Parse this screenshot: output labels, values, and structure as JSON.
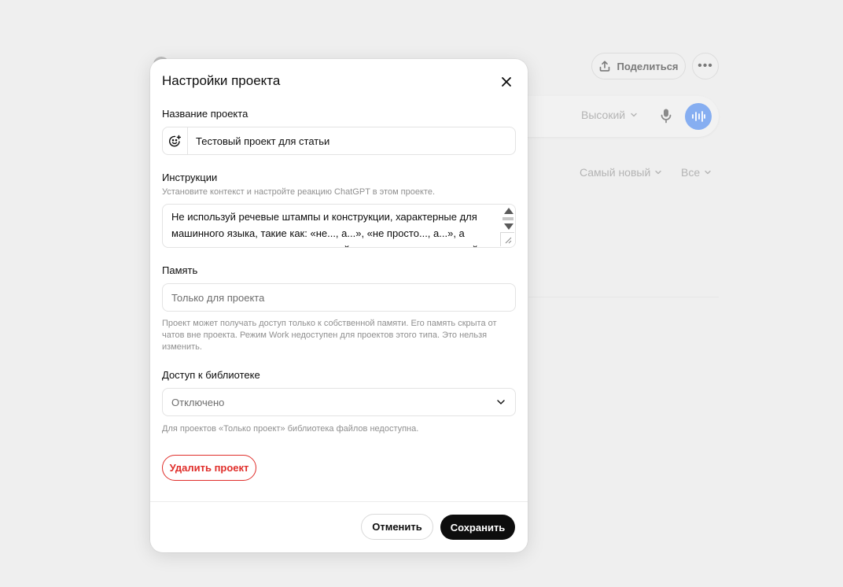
{
  "background": {
    "share_label": "Поделиться",
    "more_label": "•••",
    "level_label": "Высокий",
    "sort_label": "Самый новый",
    "filter_label": "Все",
    "voice_color": "#86aef1"
  },
  "modal": {
    "title": "Настройки проекта",
    "name": {
      "label": "Название проекта",
      "value": "Тестовый проект для статьи"
    },
    "instructions": {
      "label": "Инструкции",
      "hint": "Установите контекст и настройте реакцию ChatGPT в этом проекте.",
      "value": "Не используй речевые штампы и конструкции, характерные для машинного языка, такие как: «не..., а...», «не просто..., а...», а также клише вроде «пугающе точный», «психологически точный»"
    },
    "memory": {
      "label": "Память",
      "value": "Только для проекта",
      "hint": "Проект может получать доступ только к собственной памяти. Его память скрыта от чатов вне проекта. Режим Work недоступен для проектов этого типа. Это нельзя изменить."
    },
    "library": {
      "label": "Доступ к библиотеке",
      "value": "Отключено",
      "hint": "Для проектов «Только проект» библиотека файлов недоступна."
    },
    "delete_label": "Удалить проект",
    "cancel_label": "Отменить",
    "save_label": "Сохранить",
    "danger_color": "#e02e2a"
  }
}
